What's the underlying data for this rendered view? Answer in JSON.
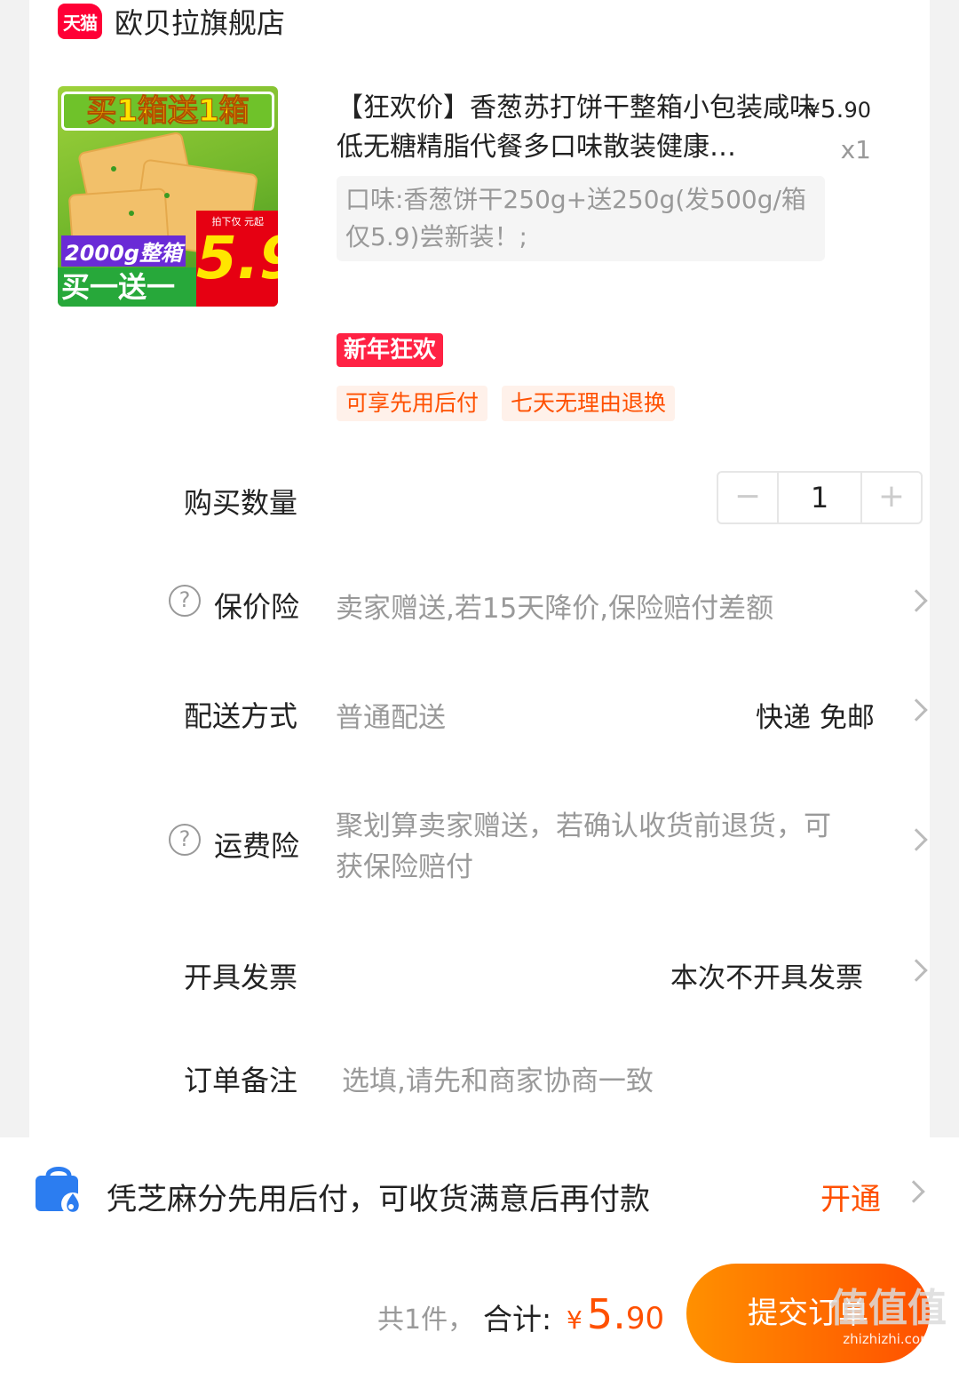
{
  "store": {
    "badge": "天猫",
    "name": "欧贝拉旗舰店"
  },
  "product": {
    "image": {
      "banner": "买1箱送1箱",
      "weight_badge": "2000g整箱",
      "bottom_banner": "买一送一",
      "price_note": "拍下仅 元起",
      "price_big": "5.9"
    },
    "title": "【狂欢价】香葱苏打饼干整箱小包装咸味低无糖精脂代餐多口味散装健康…",
    "price_currency": "¥",
    "price_int": "5.",
    "price_dec": "90",
    "quantity_mark": "x1",
    "sku": "口味:香葱饼干250g+送250g(发500g/箱仅5.9)尝新装！;",
    "promo_tag": "新年狂欢",
    "service_tags": [
      "可享先用后付",
      "七天无理由退换"
    ]
  },
  "quantity": {
    "label": "购买数量",
    "minus": "−",
    "value": "1",
    "plus": "+"
  },
  "price_insurance": {
    "help": "?",
    "label": "保价险",
    "value": "卖家赠送,若15天降价,保险赔付差额"
  },
  "delivery": {
    "label": "配送方式",
    "value": "普通配送",
    "right": "快递 免邮"
  },
  "shipping_insurance": {
    "help": "?",
    "label": "运费险",
    "value_line1": "聚划算卖家赠送，若确认收货前退货，可",
    "value_line2": "获保险赔付"
  },
  "invoice": {
    "label": "开具发票",
    "right": "本次不开具发票"
  },
  "remark": {
    "label": "订单备注",
    "placeholder": "选填,请先和商家协商一致"
  },
  "paylater": {
    "text": "凭芝麻分先用后付，可收货满意后再付款",
    "action": "开通"
  },
  "footer": {
    "count": "共1件，",
    "total_label": "合计:",
    "currency": "¥",
    "total_int": "5.",
    "total_dec": "90",
    "submit": "提交订单"
  },
  "watermark": {
    "logo": "值值值",
    "site": "zhizhizhi.com"
  },
  "colors": {
    "accent": "#ff5000",
    "tmall_red": "#ff0036",
    "promo_red": "#ff2244",
    "muted": "#999999"
  }
}
